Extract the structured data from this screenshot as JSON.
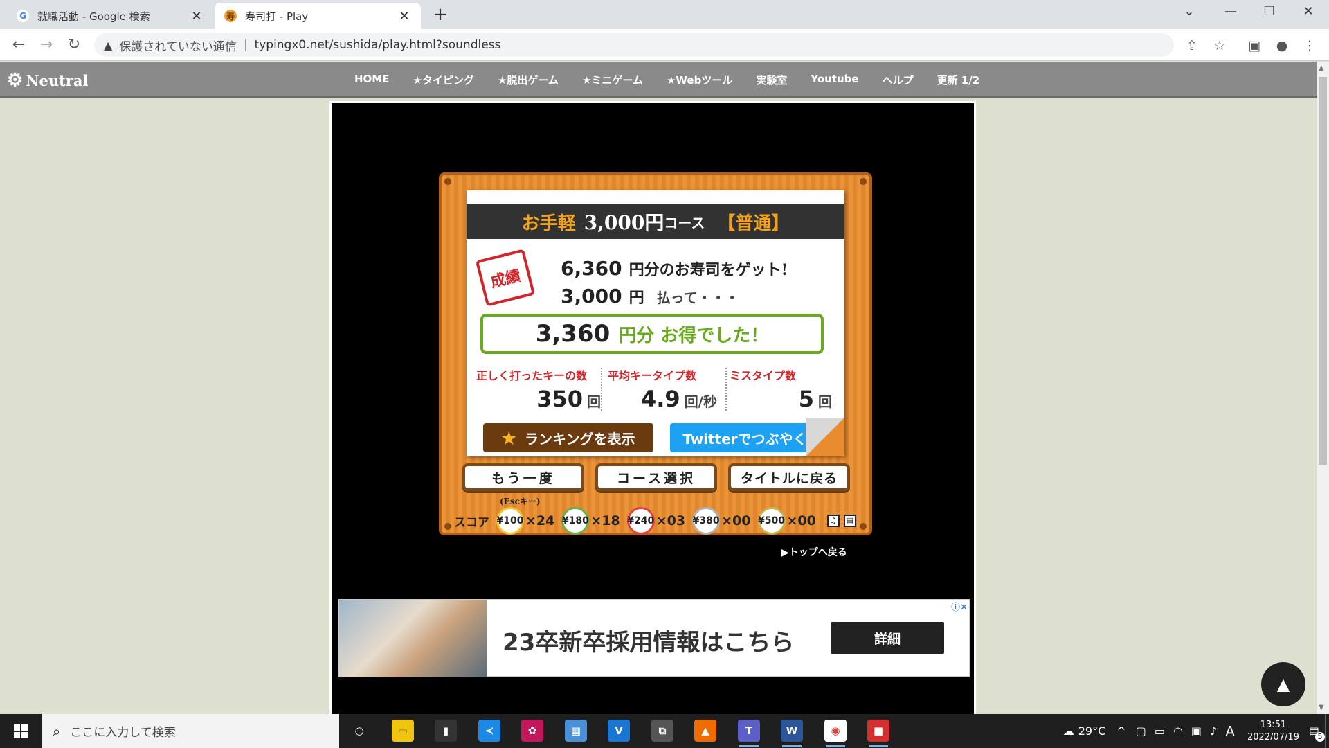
{
  "browser": {
    "tabs": [
      {
        "title": "就職活動 - Google 検索",
        "favicon": "google-icon"
      },
      {
        "title": "寿司打 - Play",
        "favicon": "sushida-icon"
      }
    ],
    "address": {
      "security_text": "保護されていない通信",
      "url": "typingx0.net/sushida/play.html?soundless"
    }
  },
  "site": {
    "logo": "Neutral",
    "nav": [
      "HOME",
      "★タイピング",
      "★脱出ゲーム",
      "★ミニゲーム",
      "★Webツール",
      "実験室",
      "Youtube",
      "ヘルプ",
      "更新 1/2"
    ]
  },
  "game": {
    "course": {
      "label": "お手軽",
      "price": "3,000円",
      "suffix": "コース",
      "difficulty": "【普通】"
    },
    "stamp": "成績",
    "earned": {
      "amount": "6,360",
      "text": "円分のお寿司をゲット!"
    },
    "paid": {
      "amount": "3,000",
      "text": "円",
      "text2": "払って・・・"
    },
    "result": {
      "amount": "3,360",
      "text": "円分 お得でした！"
    },
    "stats": [
      {
        "label": "正しく打ったキーの数",
        "value": "350",
        "unit": "回"
      },
      {
        "label": "平均キータイプ数",
        "value": "4.9",
        "unit": "回/秒"
      },
      {
        "label": "ミスタイプ数",
        "value": "5",
        "unit": "回"
      }
    ],
    "ranking_button": "ランキングを表示",
    "twitter_button": "Twitterでつぶやく",
    "buttons": [
      "もう一度",
      "コース選択",
      "タイトルに戻る"
    ],
    "esc_hint": "(Escキー)",
    "score": {
      "label": "スコア",
      "plates": [
        {
          "price": "¥100",
          "count": "×24",
          "color": "#f2c230"
        },
        {
          "price": "¥180",
          "count": "×18",
          "color": "#6ab04c"
        },
        {
          "price": "¥240",
          "count": "×03",
          "color": "#e24040"
        },
        {
          "price": "¥380",
          "count": "×00",
          "color": "#b0b0b0"
        },
        {
          "price": "¥500",
          "count": "×00",
          "color": "#c8b24a"
        }
      ]
    },
    "back_to_top": "▶トップへ戻る"
  },
  "ad": {
    "headline": "23卒新卒採用情報はこちら",
    "button": "詳細"
  },
  "taskbar": {
    "search_placeholder": "ここに入力して検索",
    "weather": "29°C",
    "ime": "A",
    "time": "13:51",
    "date": "2022/07/19",
    "notifications": "5"
  }
}
